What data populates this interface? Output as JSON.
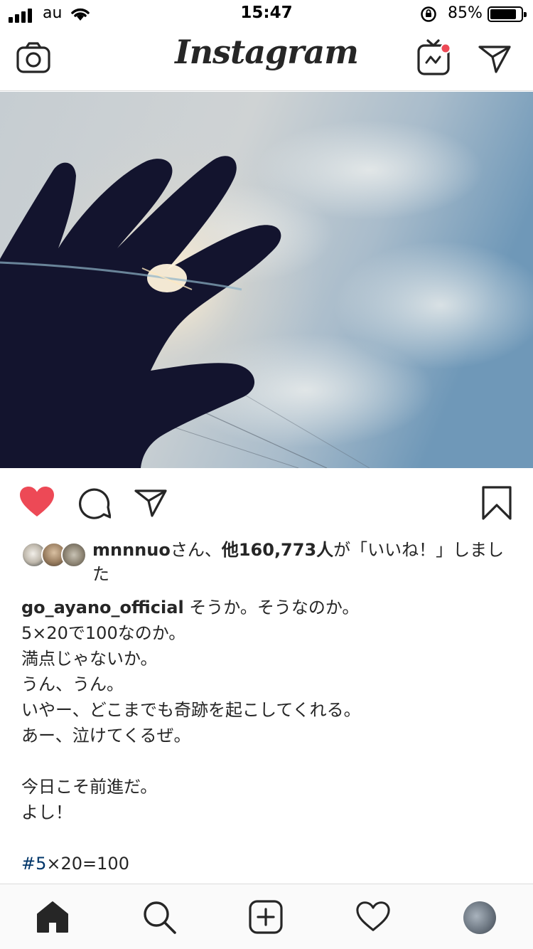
{
  "status_bar": {
    "carrier": "au",
    "time": "15:47",
    "battery_percent_label": "85%",
    "battery_level": 0.85
  },
  "header": {
    "logo": "Instagram"
  },
  "post": {
    "liked": true,
    "likes": {
      "first_user": "mnnnuo",
      "joiner": "さん、",
      "others": "他160,773人",
      "suffix": "が「いいね！」しました"
    },
    "caption": {
      "username": "go_ayano_official",
      "text": " そうか。そうなのか。\n5×20で100なのか。\n満点じゃないか。\nうん、うん。\nいやー、どこまでも奇跡を起こしてくれる。\nあー、泣けてくるぜ。\n\n今日こそ前進だ。\nよし！"
    },
    "hashtag": {
      "tag": "#5",
      "rest": "×20=100"
    }
  },
  "colors": {
    "like_red": "#ed4956",
    "hashtag_blue": "#003569",
    "text": "#262626",
    "divider": "#dbdbdb",
    "igtv_dot": "#ed4956"
  },
  "icons": {
    "header_left": "camera-icon",
    "header_right": [
      "igtv-icon",
      "direct-message-icon"
    ],
    "actions": [
      "heart-filled-icon",
      "comment-icon",
      "share-icon",
      "bookmark-icon"
    ],
    "tabbar": [
      "home-icon",
      "search-icon",
      "add-post-icon",
      "activity-heart-icon",
      "profile-avatar"
    ]
  }
}
